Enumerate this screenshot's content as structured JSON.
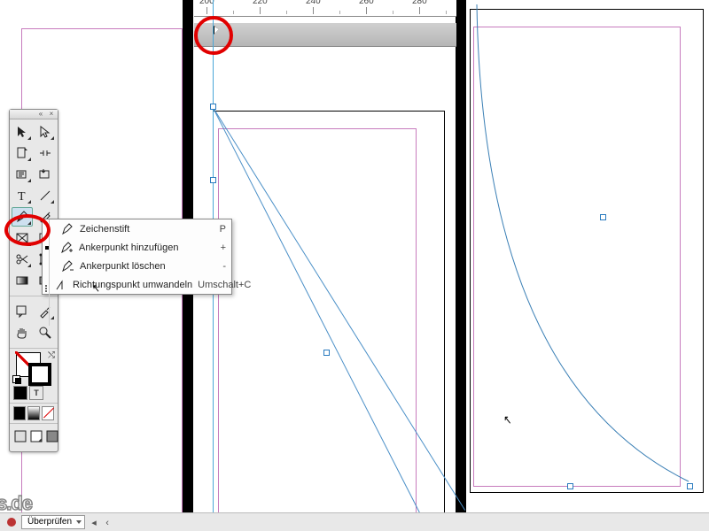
{
  "ruler_ticks": [
    "200",
    "220",
    "240",
    "260",
    "280"
  ],
  "toolbox": {
    "close_glyph": "×",
    "collapse_glyph": "«"
  },
  "pen_flyout": [
    {
      "label": "Zeichenstift",
      "shortcut": "P"
    },
    {
      "label": "Ankerpunkt hinzufügen",
      "shortcut": "+"
    },
    {
      "label": "Ankerpunkt löschen",
      "shortcut": "-"
    },
    {
      "label": "Richtungspunkt umwandeln",
      "shortcut": "Umschalt+C"
    }
  ],
  "status_bar": {
    "label": "Überprüfen"
  },
  "watermark": "s.de",
  "cursor_glyph": "↖"
}
